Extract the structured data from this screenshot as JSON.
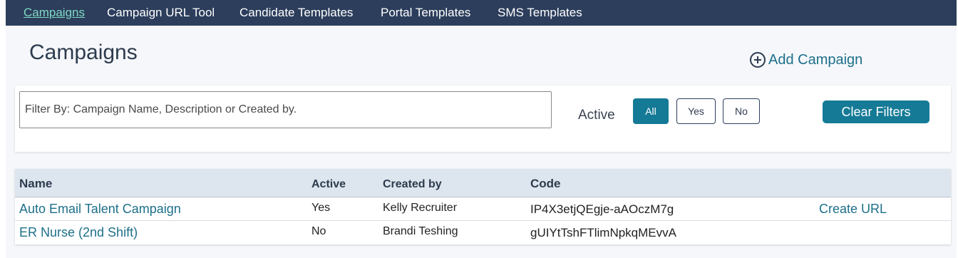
{
  "nav": {
    "items": [
      {
        "label": "Campaigns",
        "active": true
      },
      {
        "label": "Campaign URL Tool"
      },
      {
        "label": "Candidate Templates"
      },
      {
        "label": "Portal Templates"
      },
      {
        "label": "SMS Templates"
      }
    ]
  },
  "page": {
    "title": "Campaigns",
    "add_label": "Add Campaign",
    "add_icon": "plus-circle-icon"
  },
  "filters": {
    "placeholder": "Filter By: Campaign Name, Description or Created by.",
    "active_label": "Active",
    "options": [
      "All",
      "Yes",
      "No"
    ],
    "selected": "All",
    "clear_label": "Clear Filters"
  },
  "table": {
    "headers": [
      "Name",
      "Active",
      "Created by",
      "Code"
    ],
    "rows": [
      {
        "name": "Auto Email Talent Campaign",
        "active": "Yes",
        "created_by": "Kelly Recruiter",
        "code": "IP4X3etjQEgje-aAOczM7g",
        "action": "Create URL"
      },
      {
        "name": "ER Nurse (2nd Shift)",
        "active": "No",
        "created_by": "Brandi Teshing",
        "code": "gUIYtTshFTlimNpkqMEvvA",
        "action": ""
      }
    ]
  },
  "colors": {
    "nav_bg": "#2c3e5c",
    "nav_active": "#7fd8c3",
    "accent": "#157a96",
    "link": "#1d6f8a"
  }
}
